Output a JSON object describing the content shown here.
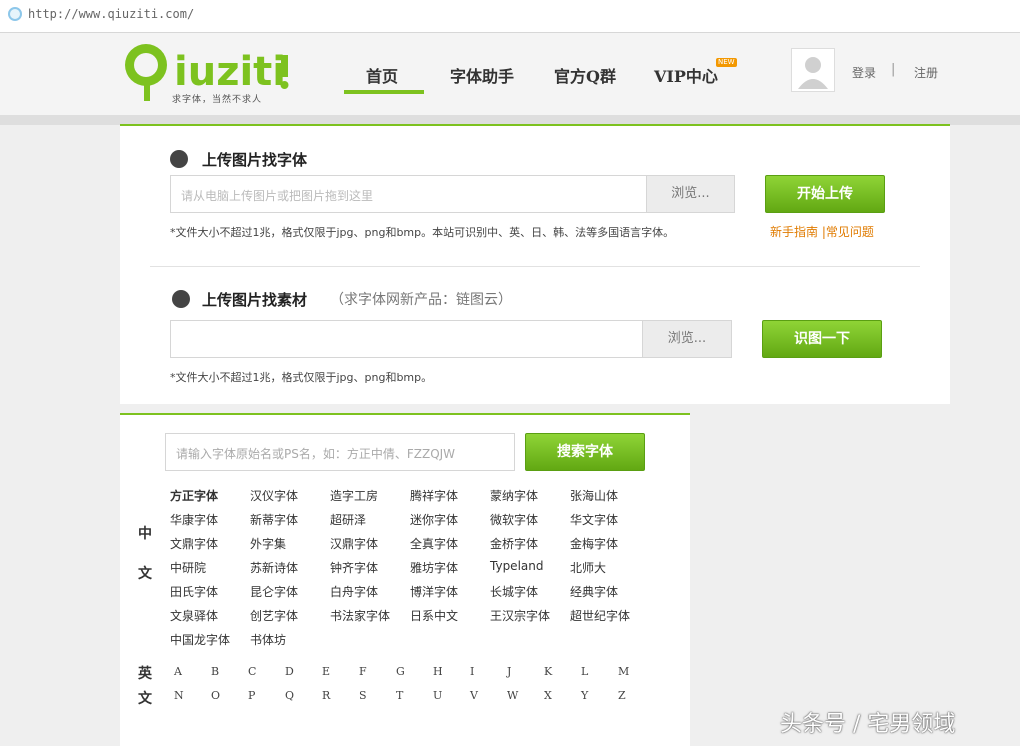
{
  "browser": {
    "url": "http://www.qiuziti.com/"
  },
  "brand": {
    "logo_text": "Qiuziti",
    "slogan": "求字体，当然不求人",
    "accent": "#7dc21f"
  },
  "nav": {
    "items": [
      "首页",
      "字体助手",
      "官方Q群",
      "VIP中心"
    ],
    "new_badge": "NEW",
    "login": "登录",
    "separator": "|",
    "register": "注册"
  },
  "upload_font": {
    "title": "上传图片找字体",
    "placeholder": "请从电脑上传图片或把图片拖到这里",
    "browse": "浏览...",
    "start_button": "开始上传",
    "note": "*文件大小不超过1兆，格式仅限于jpg、png和bmp。本站可识别中、英、日、韩、法等多国语言字体。",
    "help": "新手指南 |常见问题"
  },
  "upload_material": {
    "title": "上传图片找素材",
    "subtitle": "（求字体网新产品：链图云）",
    "browse": "浏览...",
    "button": "识图一下",
    "note": "*文件大小不超过1兆，格式仅限于jpg、png和bmp。"
  },
  "search": {
    "placeholder": "请输入字体原始名或PS名，如：方正中倩、FZZQJW",
    "button": "搜索字体",
    "chinese_label": [
      "中",
      "文"
    ],
    "english_label": [
      "英",
      "文"
    ],
    "chinese_fonts": [
      [
        "方正字体",
        "汉仪字体",
        "造字工房",
        "腾祥字体",
        "蒙纳字体",
        "张海山体"
      ],
      [
        "华康字体",
        "新蒂字体",
        "超研泽",
        "迷你字体",
        "微软字体",
        "华文字体"
      ],
      [
        "文鼎字体",
        "外字集",
        "汉鼎字体",
        "全真字体",
        "金桥字体",
        "金梅字体"
      ],
      [
        "中研院",
        "苏新诗体",
        "钟齐字体",
        "雅坊字体",
        "Typeland",
        "北师大"
      ],
      [
        "田氏字体",
        "昆仑字体",
        "白舟字体",
        "博洋字体",
        "长城字体",
        "经典字体"
      ],
      [
        "文泉驿体",
        "创艺字体",
        "书法家字体",
        "日系中文",
        "王汉宗字体",
        "超世纪字体"
      ],
      [
        "中国龙字体",
        "书体坊"
      ]
    ],
    "letters_row1": [
      "A",
      "B",
      "C",
      "D",
      "E",
      "F",
      "G",
      "H",
      "I",
      "J",
      "K",
      "L",
      "M"
    ],
    "letters_row2": [
      "N",
      "O",
      "P",
      "Q",
      "R",
      "S",
      "T",
      "U",
      "V",
      "W",
      "X",
      "Y",
      "Z"
    ]
  },
  "watermark": "头条号 / 宅男领域"
}
